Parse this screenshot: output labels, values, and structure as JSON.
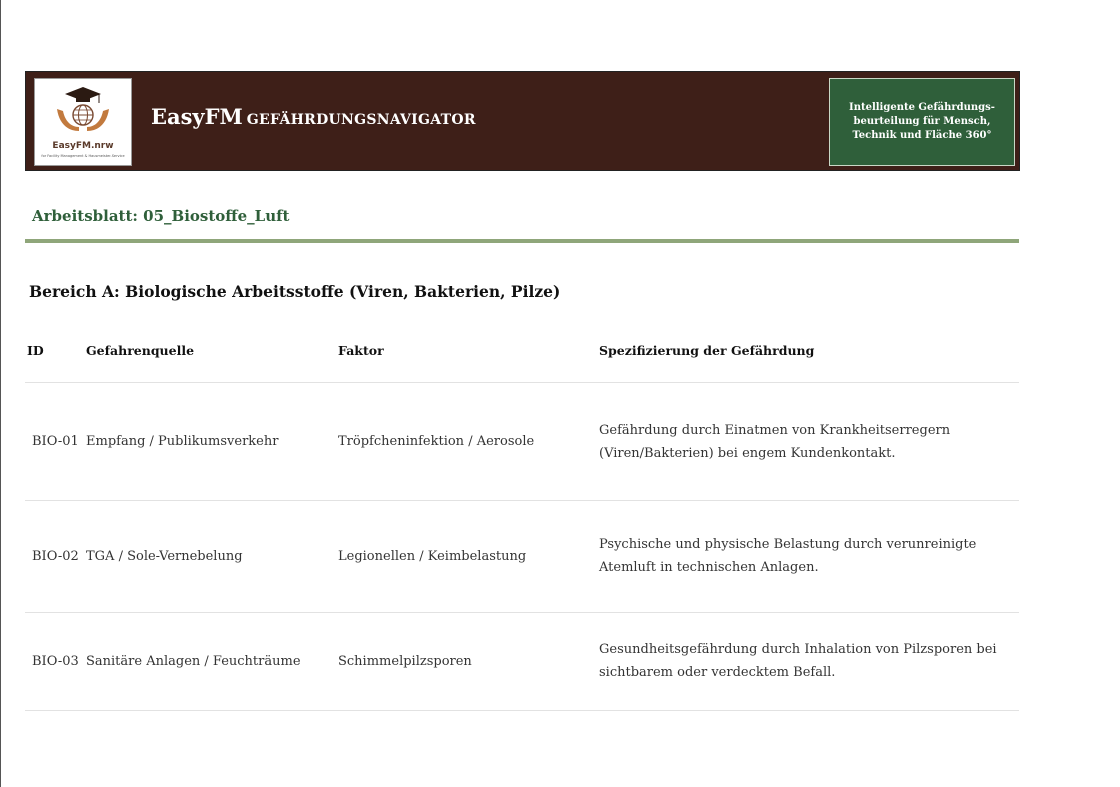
{
  "header": {
    "logo_name": "EasyFM.nrw",
    "logo_tagline": "for Facility Management & Hausmeister-Service",
    "brand_main": "EasyFM",
    "brand_sub": "GEFÄHRDUNGSNAVIGATOR",
    "tagline": "Intelligente Gefährdungs-beurteilung für Mensch, Technik und Fläche 360°",
    "colors": {
      "banner": "#3e1f18",
      "tagline_box": "#2f5f3a",
      "accent": "#8fa67a"
    }
  },
  "worksheet": {
    "title": "Arbeitsblatt: 05_Biostoffe_Luft"
  },
  "section": {
    "heading": "Bereich A: Biologische Arbeitsstoffe (Viren, Bakterien, Pilze)"
  },
  "table": {
    "columns": [
      "ID",
      "Gefahrenquelle",
      "Faktor",
      "Spezifizierung der Gefährdung"
    ],
    "rows": [
      {
        "id": "BIO-01",
        "source": "Empfang / Publikumsverkehr",
        "factor": "Tröpfcheninfektion / Aerosole",
        "spec": "Gefährdung durch Einatmen von Krankheitserregern (Viren/Bakterien) bei engem Kundenkontakt."
      },
      {
        "id": "BIO-02",
        "source": "TGA / Sole-Vernebelung",
        "factor": "Legionellen / Keimbelastung",
        "spec": "Psychische und physische Belastung durch verunreinigte Atemluft in technischen Anlagen."
      },
      {
        "id": "BIO-03",
        "source": "Sanitäre Anlagen / Feuchträume",
        "factor": "Schimmelpilzsporen",
        "spec": "Gesundheitsgefährdung durch Inhalation von Pilzsporen bei sichtbarem oder verdecktem Befall."
      }
    ]
  }
}
